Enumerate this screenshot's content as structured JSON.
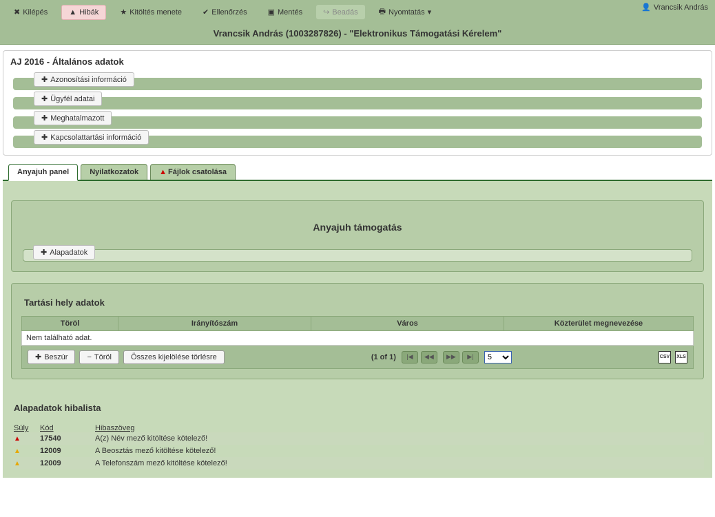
{
  "toolbar": {
    "exit": "Kilépés",
    "errors": "Hibák",
    "fill_process": "Kitöltés menete",
    "check": "Ellenőrzés",
    "save": "Mentés",
    "submit": "Beadás",
    "print": "Nyomtatás"
  },
  "user": {
    "name": "Vrancsik András"
  },
  "page_subtitle": "Vrancsik András (1003287826) - \"Elektronikus Támogatási Kérelem\"",
  "general_panel": {
    "title": "AJ 2016 - Általános adatok",
    "sections": {
      "id_info": "Azonosítási információ",
      "client_data": "Ügyfél adatai",
      "proxy": "Meghatalmazott",
      "contact": "Kapcsolattartási információ"
    }
  },
  "tabs": {
    "anyajuh": "Anyajuh panel",
    "nyilatkozatok": "Nyilatkozatok",
    "fajlok": "Fájlok csatolása"
  },
  "support_panel": {
    "title": "Anyajuh támogatás",
    "alapadatok": "Alapadatok"
  },
  "grid": {
    "section_title": "Tartási hely adatok",
    "headers": {
      "torol": "Töröl",
      "irszam": "Irányítószám",
      "varos": "Város",
      "kozterulet": "Közterület megnevezése"
    },
    "empty": "Nem található adat.",
    "footer": {
      "insert": "Beszúr",
      "delete": "Töröl",
      "delete_all_sel": "Összes kijelölése törlésre",
      "page_info": "(1 of 1)",
      "page_size": "5"
    }
  },
  "errlist": {
    "title": "Alapadatok hibalista",
    "headers": {
      "suly": "Súly",
      "kod": "Kód",
      "msg": "Hibaszöveg"
    },
    "rows": [
      {
        "severity": "error",
        "code": "17540",
        "msg": "A(z) Név mező kitöltése kötelező!"
      },
      {
        "severity": "warn",
        "code": "12009",
        "msg": "A Beosztás mező kitöltése kötelező!"
      },
      {
        "severity": "warn",
        "code": "12009",
        "msg": "A Telefonszám mező kitöltése kötelező!"
      }
    ]
  },
  "export_labels": {
    "csv": "CSV",
    "xls": "XLS"
  }
}
